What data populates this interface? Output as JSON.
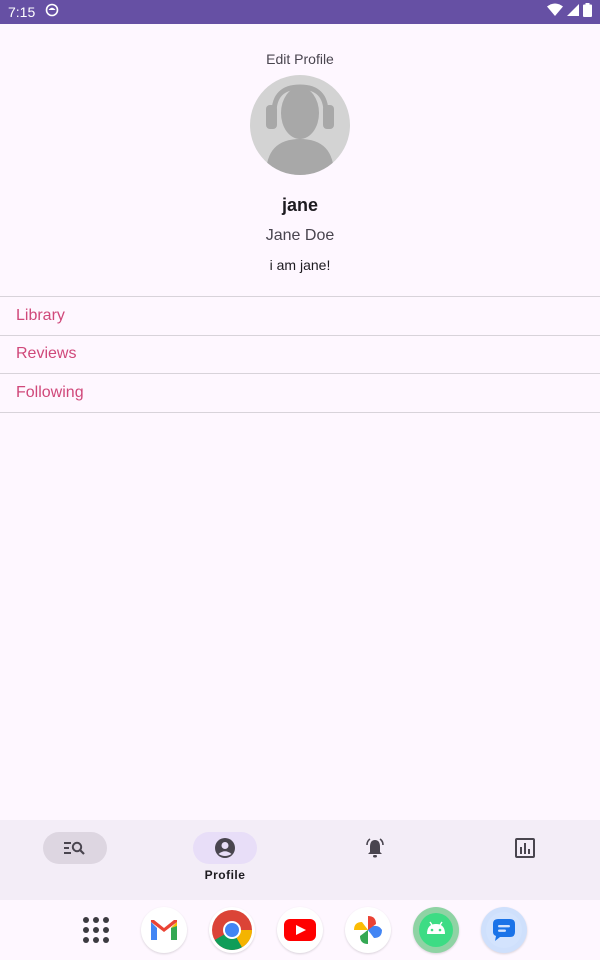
{
  "status_bar": {
    "time": "7:15"
  },
  "profile": {
    "edit_label": "Edit Profile",
    "username": "jane",
    "full_name": "Jane Doe",
    "bio": "i am jane!"
  },
  "menu": {
    "items": [
      {
        "label": "Library"
      },
      {
        "label": "Reviews"
      },
      {
        "label": "Following"
      }
    ]
  },
  "bottom_nav": {
    "items": [
      {
        "icon": "search-list-icon",
        "label": ""
      },
      {
        "icon": "account-circle-icon",
        "label": "Profile"
      },
      {
        "icon": "notification-bell-icon",
        "label": ""
      },
      {
        "icon": "bar-chart-icon",
        "label": ""
      }
    ],
    "active_index": 1
  },
  "dock": {
    "apps": [
      "app-drawer-icon",
      "gmail-icon",
      "chrome-icon",
      "youtube-icon",
      "photos-icon",
      "android-icon",
      "messages-icon"
    ]
  },
  "colors": {
    "status_bar": "#6650A4",
    "accent_text": "#D0487A",
    "background": "#FEF7FF",
    "nav_background": "#F3EDF7",
    "nav_active_pill": "#E8DEF8"
  }
}
